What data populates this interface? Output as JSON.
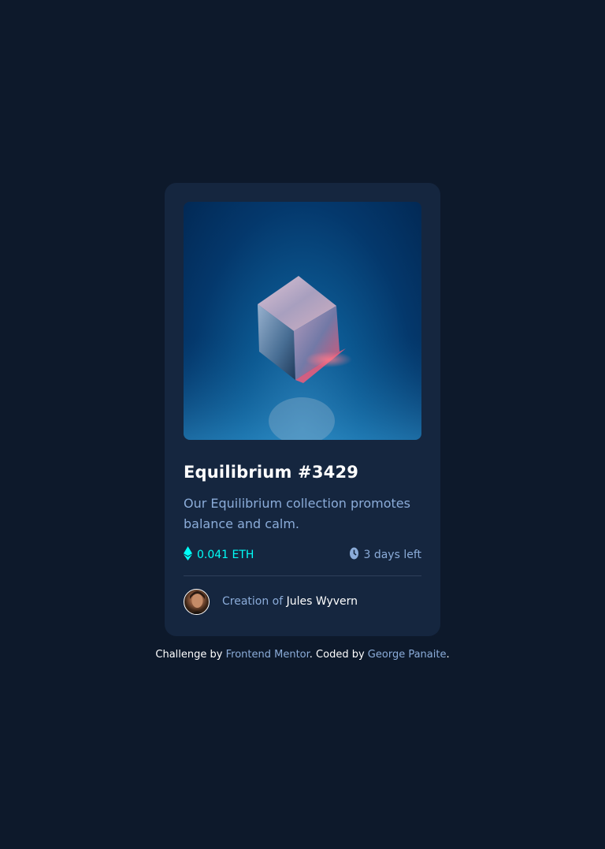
{
  "card": {
    "title": "Equilibrium #3429",
    "description": "Our Equilibrium collection promotes balance and calm.",
    "price": "0.041 ETH",
    "time_left": "3 days left",
    "creator_prefix": "Creation of",
    "creator_name": "Jules Wyvern"
  },
  "icons": {
    "price": "ethereum-icon",
    "time": "clock-icon"
  },
  "attribution": {
    "prefix": "Challenge by",
    "link1": "Frontend Mentor",
    "middle": ". Coded by",
    "link2": "George Panaite",
    "suffix": "."
  },
  "colors": {
    "background": "#0d192b",
    "card": "#15263f",
    "cyan": "#00fff8",
    "soft_blue": "#8bacd9",
    "white": "#ffffff"
  }
}
